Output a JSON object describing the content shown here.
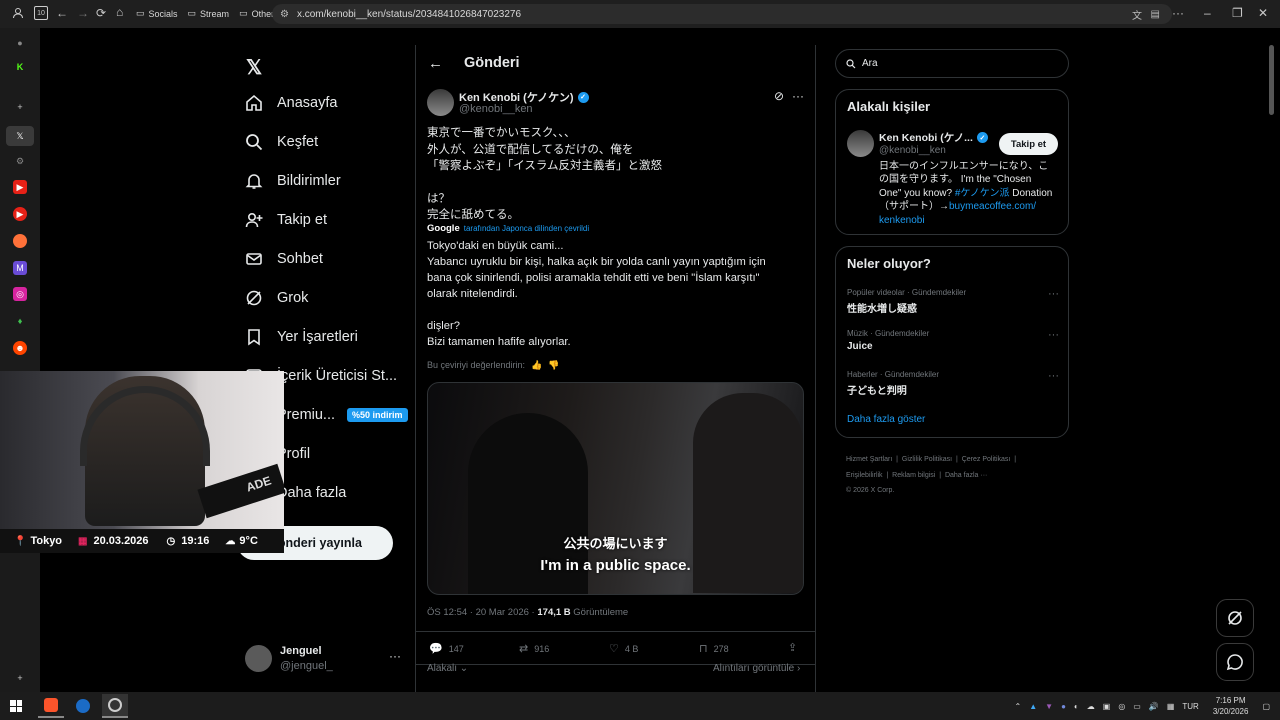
{
  "browser": {
    "tab_count": "10",
    "bookmarks": [
      "Socials",
      "Stream",
      "Others"
    ],
    "url": "x.com/kenobi__ken/status/2034841026847023276"
  },
  "nav": {
    "items": [
      "Anasayfa",
      "Keşfet",
      "Bildirimler",
      "Takip et",
      "Sohbet",
      "Grok",
      "Yer İşaretleri",
      "İçerik Üreticisi St...",
      "Premiu...",
      "Profil",
      "Daha fazla"
    ],
    "premium_badge": "%50 indirim",
    "post_button": "Gönderi yayınla",
    "account_name": "Jenguel",
    "account_handle": "@jenguel_"
  },
  "post": {
    "header_title": "Gönderi",
    "author_name": "Ken Kenobi (ケノケン)",
    "author_handle": "@kenobi__ken",
    "original_lines": [
      "東京で一番でかいモスク、、、",
      "外人が、公道で配信してるだけの、俺を",
      "「警察よぶぞ」「イスラム反対主義者」と激怒",
      "",
      "は？",
      "完全に舐めてる。"
    ],
    "google_label": "Google",
    "translated_from": "tarafından Japonca dilinden çevrildi",
    "translation_lines": [
      "Tokyo'daki en büyük cami...",
      "Yabancı uyruklu bir kişi, halka açık bir yolda canlı yayın yaptığım için",
      "bana çok sinirlendi, polisi aramakla tehdit etti ve beni \"İslam karşıtı\"",
      "olarak nitelendirdi.",
      "",
      "dişler?",
      "Bizi tamamen hafife alıyorlar."
    ],
    "rate_text": "Bu çeviriyi değerlendirin:",
    "video_subtitle_jp": "公共の場にいます",
    "video_subtitle_en": "I'm in a public space.",
    "timestamp": "ÖS 12:54 · 20 Mar 2026 ·",
    "views_count": "174,1 B",
    "views_label": "Görüntüleme",
    "replies": "147",
    "reposts": "916",
    "likes": "4 B",
    "bookmarks": "278",
    "relevant_label": "Alakalı",
    "quotes_label": "Alıntıları görüntüle"
  },
  "right": {
    "search_placeholder": "Ara",
    "people_title": "Alakalı kişiler",
    "person_name": "Ken Kenobi (ケノ...",
    "person_handle": "@kenobi__ken",
    "follow_label": "Takip et",
    "bio_lines": [
      "日本一のインフルエンサーになり、こ",
      "の国を守ります。 I'm the \"Chosen",
      "One\" you know?"
    ],
    "bio_hashtag": "#ケノケン派",
    "bio_donation": "Donation",
    "bio_support": "（サポート）→",
    "bio_link1": "buymeacoffee.com/",
    "bio_link2": "kenkenobi",
    "trends_title": "Neler oluyor?",
    "trends": [
      {
        "meta": "Popüler videolar · Gündemdekiler",
        "title": "性能水増し疑惑"
      },
      {
        "meta": "Müzik · Gündemdekiler",
        "title": "Juice"
      },
      {
        "meta": "Haberler · Gündemdekiler",
        "title": "子どもと判明"
      }
    ],
    "show_more": "Daha fazla göster",
    "footer_line1": [
      "Hizmet Şartları",
      "Gizlilik Politikası",
      "Çerez Politikası"
    ],
    "footer_line2": [
      "Erişilebilirlik",
      "Reklam bilgisi",
      "Daha fazla ···"
    ],
    "copyright": "© 2026 X Corp."
  },
  "overlay": {
    "location": "Tokyo",
    "date": "20.03.2026",
    "time": "19:16",
    "weather": "9°C",
    "cap_text": "ADE"
  },
  "taskbar": {
    "lang": "TUR",
    "clock_time": "7:16 PM",
    "clock_date": "3/20/2026"
  },
  "colors": {
    "accent": "#1d9bf0",
    "bg": "#000000",
    "border": "#2f3336",
    "muted": "#71767b"
  }
}
